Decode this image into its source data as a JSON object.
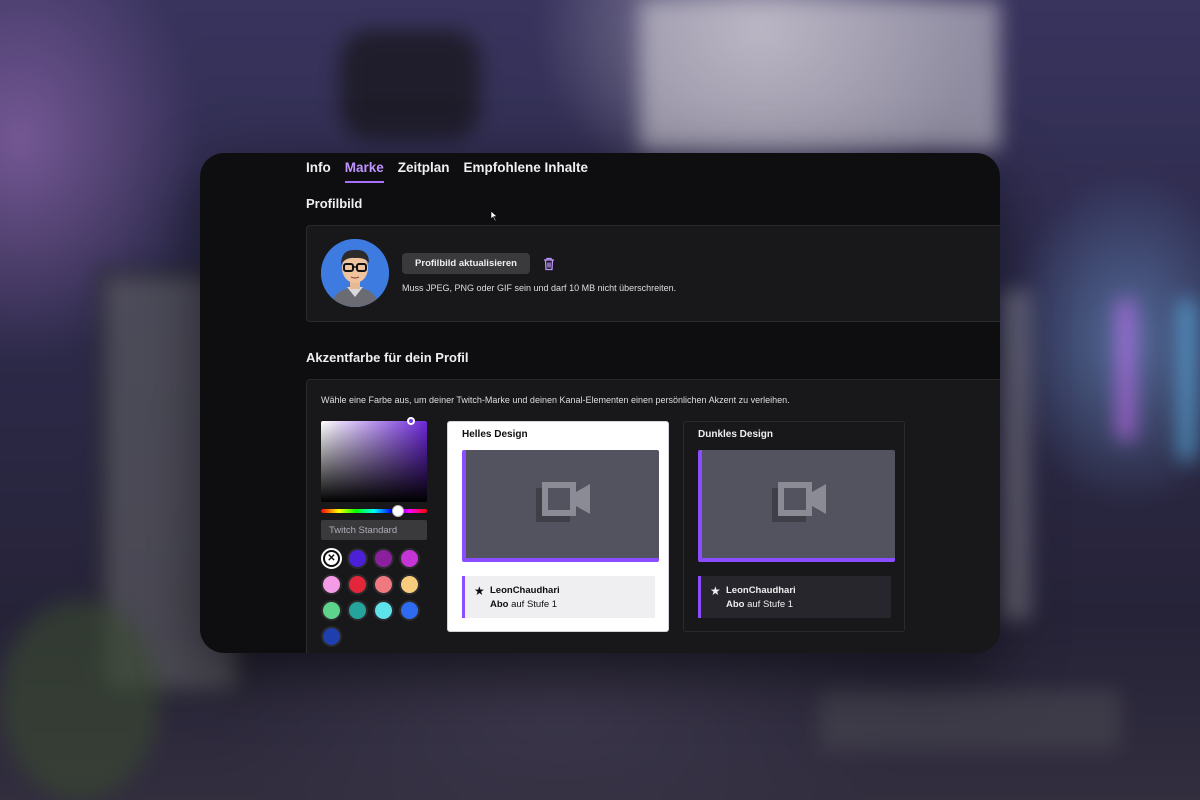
{
  "tabs": [
    {
      "label": "Info",
      "active": false
    },
    {
      "label": "Marke",
      "active": true
    },
    {
      "label": "Zeitplan",
      "active": false
    },
    {
      "label": "Empfohlene Inhalte",
      "active": false
    }
  ],
  "profile": {
    "title": "Profilbild",
    "update_button": "Profilbild aktualisieren",
    "delete_icon": "trash-icon",
    "hint": "Muss JPEG, PNG oder GIF sein und darf 10 MB nicht überschreiten."
  },
  "accent": {
    "title": "Akzentfarbe für dein Profil",
    "description": "Wähle eine Farbe aus, um deiner Twitch-Marke und deinen Kanal-Elementen einen persönlichen Akzent zu verleihen.",
    "color_input_value": "Twitch Standard",
    "swatches": [
      "#0e0e10",
      "#4c1fd9",
      "#8b1f9e",
      "#c535d6",
      "#f39be7",
      "#e3263a",
      "#f0797f",
      "#f7cc7d",
      "#5ed38c",
      "#25a49c",
      "#5ee2eb",
      "#2f6af2",
      "#1e40af"
    ],
    "selected_swatch": 0
  },
  "previews": {
    "light": {
      "title": "Helles Design",
      "username": "LeonChaudhari",
      "sub_bold": "Abo",
      "sub_rest": " auf Stufe 1"
    },
    "dark": {
      "title": "Dunkles Design",
      "username": "LeonChaudhari",
      "sub_bold": "Abo",
      "sub_rest": " auf Stufe 1"
    }
  },
  "colors": {
    "accent": "#a970ff",
    "panel": "#18181b",
    "page": "#0e0e10"
  }
}
